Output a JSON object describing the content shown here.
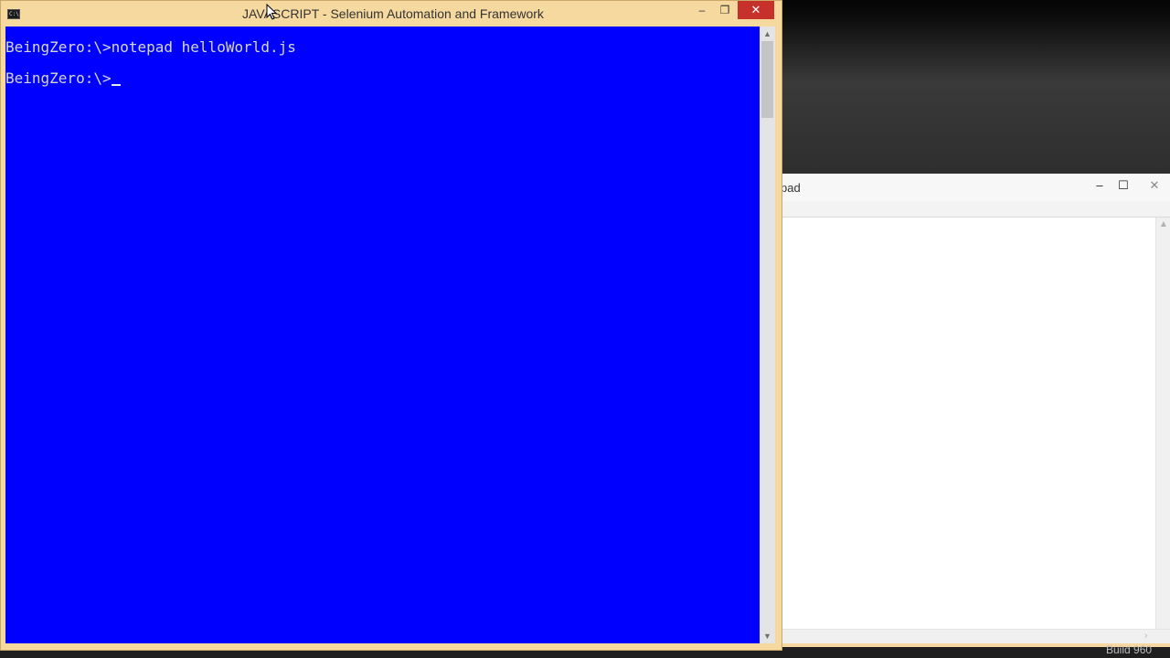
{
  "console": {
    "title": "JAVASCRIPT - Selenium Automation and Framework",
    "icon": "command-prompt-icon",
    "icon_text": "C:\\",
    "buttons": {
      "minimize": "–",
      "restore": "❐",
      "close": "✕"
    },
    "lines": [
      "BeingZero:\\>notepad helloWorld.js",
      "BeingZero:\\>"
    ],
    "colors": {
      "background": "#0000ff",
      "text": "#d7d7d7",
      "frame": "#f6d99f",
      "close": "#c7312b"
    }
  },
  "notepad": {
    "title_fragment": "pad",
    "buttons": {
      "minimize": "–",
      "maximize": "☐",
      "close": "✕"
    }
  },
  "taskbar": {
    "text_fragment": "Build 960"
  }
}
